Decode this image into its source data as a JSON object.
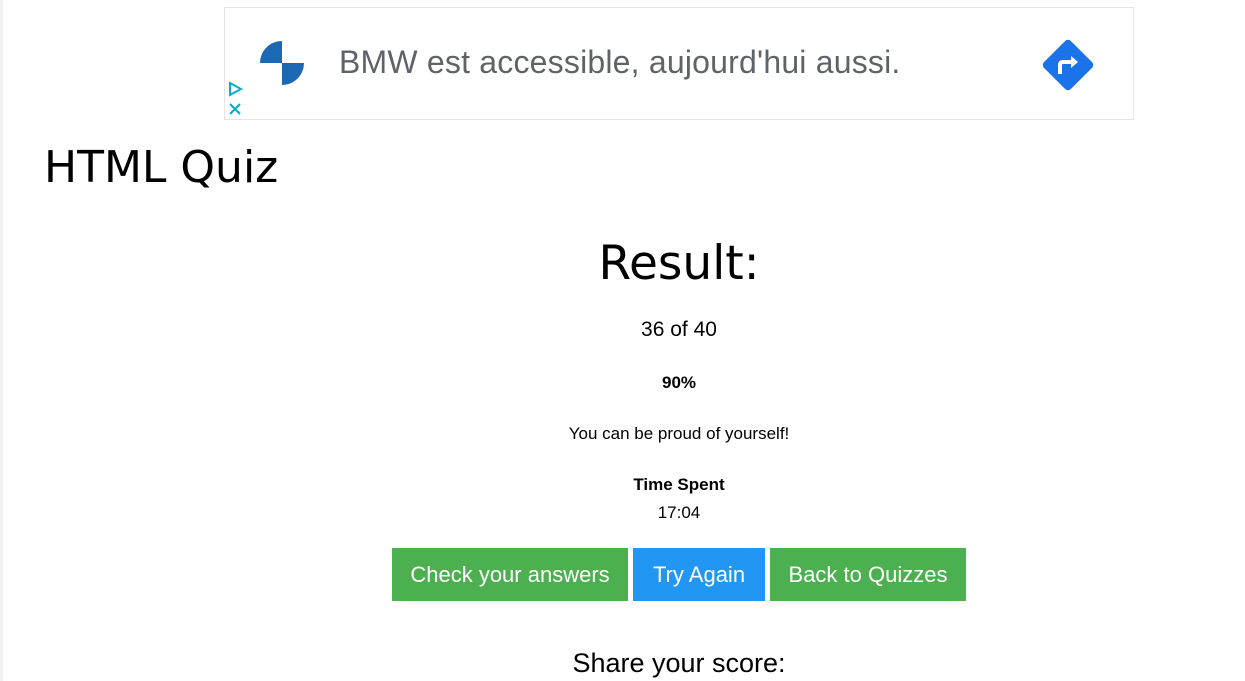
{
  "ad": {
    "text": "BMW est accessible, aujourd'hui aussi.",
    "logo_colors": [
      "#1c69b3",
      "#ffffff"
    ],
    "cta_color": "#1a73e8",
    "choices_color": "#00aecd",
    "icons": [
      "bmw-logo-icon",
      "directions-arrow-icon",
      "ad-choices-icon",
      "close-icon"
    ]
  },
  "page": {
    "title": "HTML Quiz"
  },
  "result": {
    "heading": "Result:",
    "score": "36 of 40",
    "percent": "90%",
    "message": "You can be proud of yourself!",
    "time_label": "Time Spent",
    "time_value": "17:04"
  },
  "buttons": {
    "check": "Check your answers",
    "try_again": "Try Again",
    "back": "Back to Quizzes"
  },
  "share": {
    "label": "Share your score:"
  },
  "colors": {
    "green": "#4caf50",
    "blue": "#2196f3"
  }
}
